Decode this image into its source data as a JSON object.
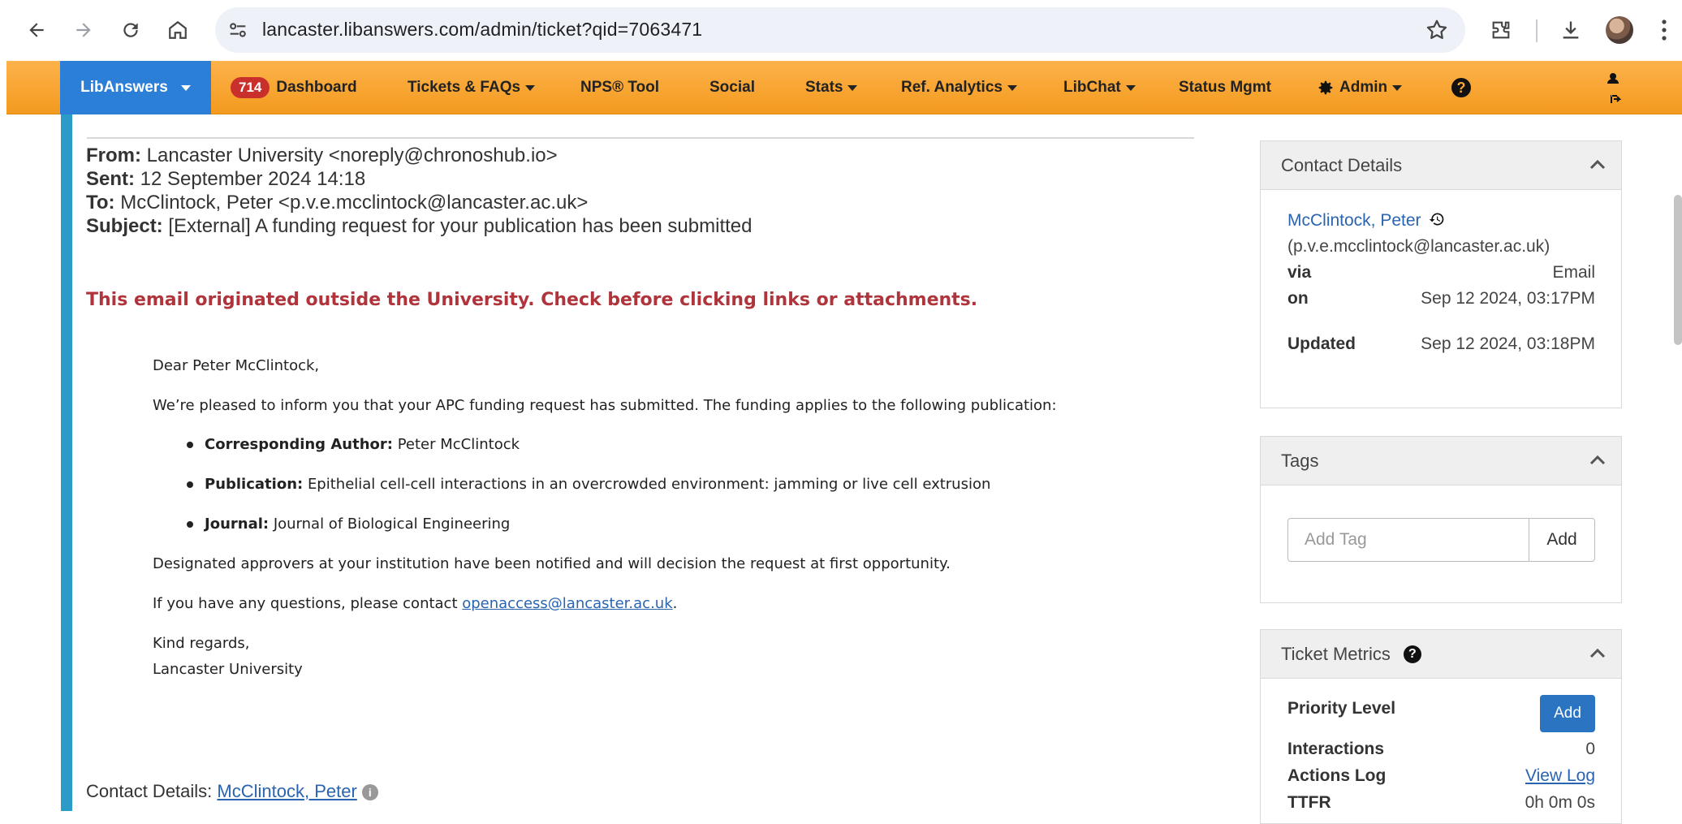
{
  "browser": {
    "url": "lancaster.libanswers.com/admin/ticket?qid=7063471"
  },
  "navbar": {
    "brand": "LibAnswers",
    "badge_count": "714",
    "items": [
      {
        "label": "Dashboard"
      },
      {
        "label": "Tickets & FAQs"
      },
      {
        "label": "NPS® Tool"
      },
      {
        "label": "Social"
      },
      {
        "label": "Stats"
      },
      {
        "label": "Ref. Analytics"
      },
      {
        "label": "LibChat"
      },
      {
        "label": "Status Mgmt"
      },
      {
        "label": "Admin"
      }
    ]
  },
  "email": {
    "from_label": "From:",
    "from_value": "Lancaster University <noreply@chronoshub.io>",
    "sent_label": "Sent:",
    "sent_value": "12 September 2024 14:18",
    "to_label": "To:",
    "to_value": "McClintock, Peter <p.v.e.mcclintock@lancaster.ac.uk>",
    "subject_label": "Subject:",
    "subject_value": "[External] A funding request for your publication has been submitted",
    "warning": "This email originated outside the University. Check before clicking links or attachments.",
    "greeting": "Dear Peter McClintock,",
    "intro": "We’re pleased to inform you that your APC funding request has submitted. The funding applies to the following publication:",
    "bullets": [
      {
        "label": "Corresponding Author:",
        "value": "Peter McClintock"
      },
      {
        "label": "Publication:",
        "value": "Epithelial cell-cell interactions in an overcrowded environment: jamming or live cell extrusion"
      },
      {
        "label": "Journal:",
        "value": "Journal of Biological Engineering"
      }
    ],
    "approvers": "Designated approvers at your institution have been notified and will decision the request at first opportunity.",
    "questions_prefix": "If you have any questions, please contact ",
    "questions_link": "openaccess@lancaster.ac.uk",
    "questions_suffix": ".",
    "regards": "Kind regards,",
    "signature": "Lancaster University",
    "contact_label": "Contact Details:",
    "contact_link": "McClintock, Peter"
  },
  "contact_panel": {
    "title": "Contact Details",
    "name": "McClintock, Peter",
    "email": "(p.v.e.mcclintock@lancaster.ac.uk)",
    "via_label": "via",
    "via_value": "Email",
    "on_label": "on",
    "on_value": "Sep 12 2024, 03:17PM",
    "updated_label": "Updated",
    "updated_value": "Sep 12 2024, 03:18PM"
  },
  "tags_panel": {
    "title": "Tags",
    "placeholder": "Add Tag",
    "add_label": "Add"
  },
  "metrics_panel": {
    "title": "Ticket Metrics",
    "priority_label": "Priority Level",
    "priority_add": "Add",
    "interactions_label": "Interactions",
    "interactions_value": "0",
    "actions_label": "Actions Log",
    "actions_value": "View Log",
    "ttfr_label": "TTFR",
    "ttfr_value": "0h 0m 0s"
  }
}
